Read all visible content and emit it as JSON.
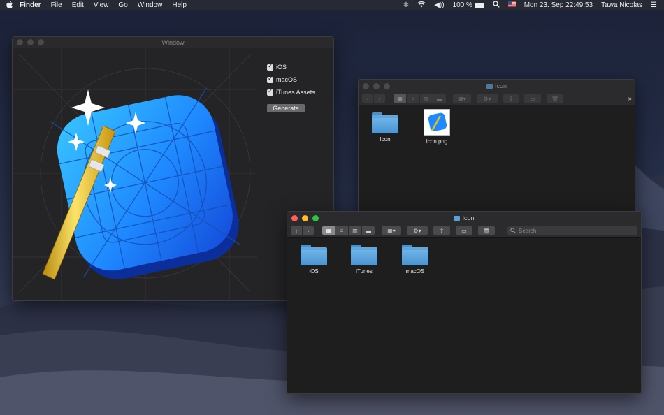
{
  "menubar": {
    "app": "Finder",
    "menus": [
      "File",
      "Edit",
      "View",
      "Go",
      "Window",
      "Help"
    ],
    "battery": "100 %",
    "datetime": "Mon 23. Sep  22:49:53",
    "user": "Tawa Nicolas"
  },
  "generator": {
    "title": "Window",
    "options": [
      {
        "label": "iOS",
        "checked": true
      },
      {
        "label": "macOS",
        "checked": true
      },
      {
        "label": "iTunes Assets",
        "checked": true
      }
    ],
    "button": "Generate"
  },
  "finder_back": {
    "title": "Icon",
    "items": [
      {
        "label": "Icon",
        "kind": "folder"
      },
      {
        "label": "Icon.png",
        "kind": "image"
      }
    ]
  },
  "finder_front": {
    "title": "Icon",
    "search_placeholder": "Search",
    "items": [
      {
        "label": "iOS",
        "kind": "folder"
      },
      {
        "label": "iTunes",
        "kind": "folder"
      },
      {
        "label": "macOS",
        "kind": "folder"
      }
    ]
  },
  "colors": {
    "accent_blue": "#1e88ff",
    "wand_gold": "#e8c020"
  }
}
